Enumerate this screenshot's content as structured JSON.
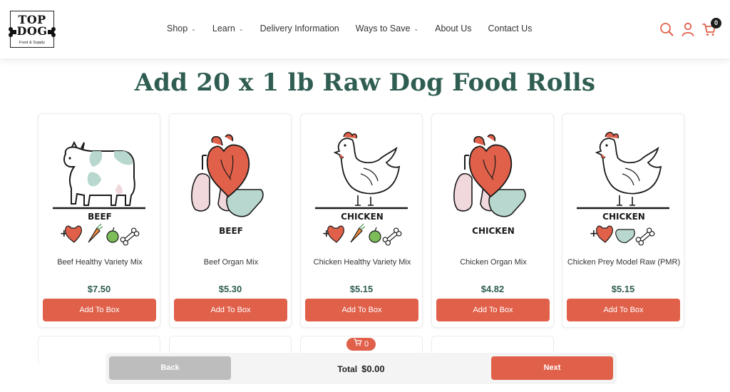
{
  "header": {
    "logo": {
      "line1": "TOP",
      "line2": "DOG",
      "tagline": "Food & Supply"
    },
    "nav": [
      {
        "label": "Shop",
        "has_dropdown": true
      },
      {
        "label": "Learn",
        "has_dropdown": true
      },
      {
        "label": "Delivery Information",
        "has_dropdown": false
      },
      {
        "label": "Ways to Save",
        "has_dropdown": true
      },
      {
        "label": "About Us",
        "has_dropdown": false
      },
      {
        "label": "Contact Us",
        "has_dropdown": false
      }
    ],
    "icons": [
      "search-icon",
      "account-icon",
      "cart-icon"
    ],
    "cart_count": "0"
  },
  "page": {
    "title": "Add 20 x 1 lb Raw Dog Food Rolls"
  },
  "products": [
    {
      "name": "Beef Healthy Variety Mix",
      "price": "$7.50",
      "button": "Add To Box",
      "art_label": "BEEF",
      "art": "cow"
    },
    {
      "name": "Beef Organ Mix",
      "price": "$5.30",
      "button": "Add To Box",
      "art_label": "BEEF",
      "art": "organs"
    },
    {
      "name": "Chicken Healthy Variety Mix",
      "price": "$5.15",
      "button": "Add To Box",
      "art_label": "CHICKEN",
      "art": "chicken"
    },
    {
      "name": "Chicken Organ Mix",
      "price": "$4.82",
      "button": "Add To Box",
      "art_label": "CHICKEN",
      "art": "organs"
    },
    {
      "name": "Chicken Prey Model Raw (PMR)",
      "price": "$5.15",
      "button": "Add To Box",
      "art_label": "CHICKEN",
      "art": "chicken"
    }
  ],
  "box": {
    "count": "0"
  },
  "footer": {
    "back_label": "Back",
    "total_label": "Total",
    "total_value": "$0.00",
    "next_label": "Next"
  },
  "colors": {
    "accent": "#e0604a",
    "title_green": "#2f5d52",
    "organ_red": "#e0604a",
    "organ_teal": "#b8d8cf",
    "organ_pink": "#f1d8dc",
    "disabled_gray": "#bdbdbd"
  }
}
